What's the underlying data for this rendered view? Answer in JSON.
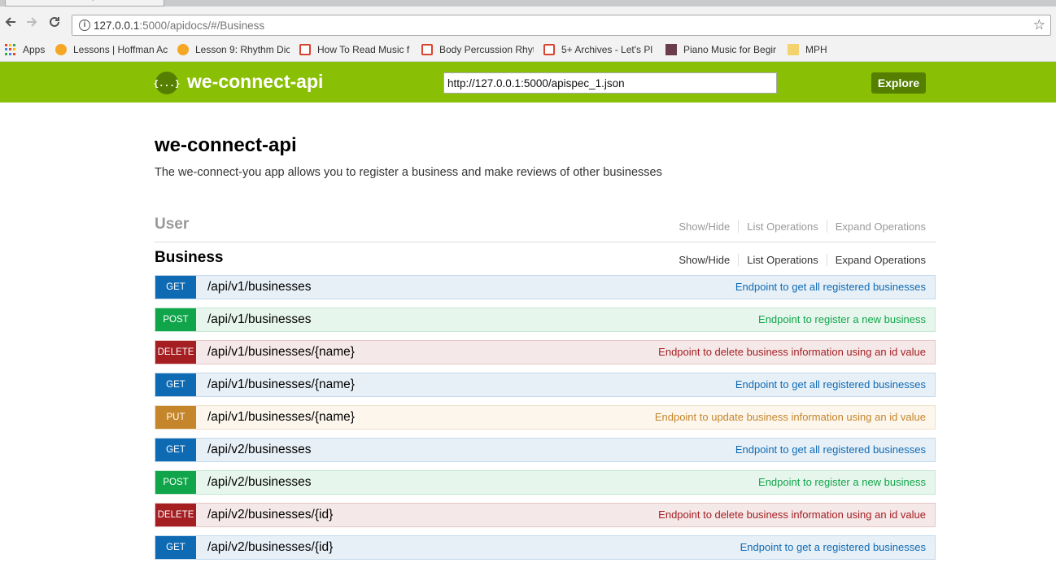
{
  "browser": {
    "tab_title": "we-connect-api",
    "url_host": "127.0.0.1",
    "url_rest": ":5000/apidocs/#/Business",
    "bookmarks": [
      {
        "label": "Apps",
        "icon": "apps-grid-icon"
      },
      {
        "label": "Lessons | Hoffman Ac",
        "icon": "orange-circle-icon"
      },
      {
        "label": "Lesson 9: Rhythm Dic",
        "icon": "orange-circle-icon"
      },
      {
        "label": "How To Read Music f",
        "icon": "red-badge-icon"
      },
      {
        "label": "Body Percussion Rhyt",
        "icon": "red-badge-icon"
      },
      {
        "label": "5+ Archives - Let's Pl",
        "icon": "red-badge-icon"
      },
      {
        "label": "Piano Music for Begir",
        "icon": "piano-icon"
      },
      {
        "label": "MPH",
        "icon": "folder-icon"
      }
    ]
  },
  "header": {
    "logo_glyph": "{...}",
    "title": "we-connect-api",
    "spec_url": "http://127.0.0.1:5000/apispec_1.json",
    "explore_label": "Explore",
    "color": "#89bf04"
  },
  "info": {
    "title": "we-connect-api",
    "description": "The we-connect-you app allows you to register a business and make reviews of other businesses"
  },
  "resources": [
    {
      "name": "User",
      "links": [
        "Show/Hide",
        "List Operations",
        "Expand Operations"
      ]
    },
    {
      "name": "Business",
      "links": [
        "Show/Hide",
        "List Operations",
        "Expand Operations"
      ]
    }
  ],
  "operations": [
    {
      "method": "GET",
      "path": "/api/v1/businesses",
      "summary": "Endpoint to get all registered businesses"
    },
    {
      "method": "POST",
      "path": "/api/v1/businesses",
      "summary": "Endpoint to register a new business"
    },
    {
      "method": "DELETE",
      "path": "/api/v1/businesses/{name}",
      "summary": "Endpoint to delete business information using an id value"
    },
    {
      "method": "GET",
      "path": "/api/v1/businesses/{name}",
      "summary": "Endpoint to get all registered businesses"
    },
    {
      "method": "PUT",
      "path": "/api/v1/businesses/{name}",
      "summary": "Endpoint to update business information using an id value"
    },
    {
      "method": "GET",
      "path": "/api/v2/businesses",
      "summary": "Endpoint to get all registered businesses"
    },
    {
      "method": "POST",
      "path": "/api/v2/businesses",
      "summary": "Endpoint to register a new business"
    },
    {
      "method": "DELETE",
      "path": "/api/v2/businesses/{id}",
      "summary": "Endpoint to delete business information using an id value"
    },
    {
      "method": "GET",
      "path": "/api/v2/businesses/{id}",
      "summary": "Endpoint to get a registered businesses"
    }
  ],
  "method_colors": {
    "GET": {
      "badge": "#0f6ab4",
      "bg": "#e7f0f7",
      "border": "#c3d9ec",
      "text": "#0f6ab4"
    },
    "POST": {
      "badge": "#10a54a",
      "bg": "#e7f6ec",
      "border": "#c3e8d1",
      "text": "#10a54a"
    },
    "DELETE": {
      "badge": "#a41e22",
      "bg": "#f5e8e8",
      "border": "#e8c6c7",
      "text": "#a41e22"
    },
    "PUT": {
      "badge": "#c5862b",
      "bg": "#fcf6ed",
      "border": "#f0e0ca",
      "text": "#c5862b"
    }
  }
}
